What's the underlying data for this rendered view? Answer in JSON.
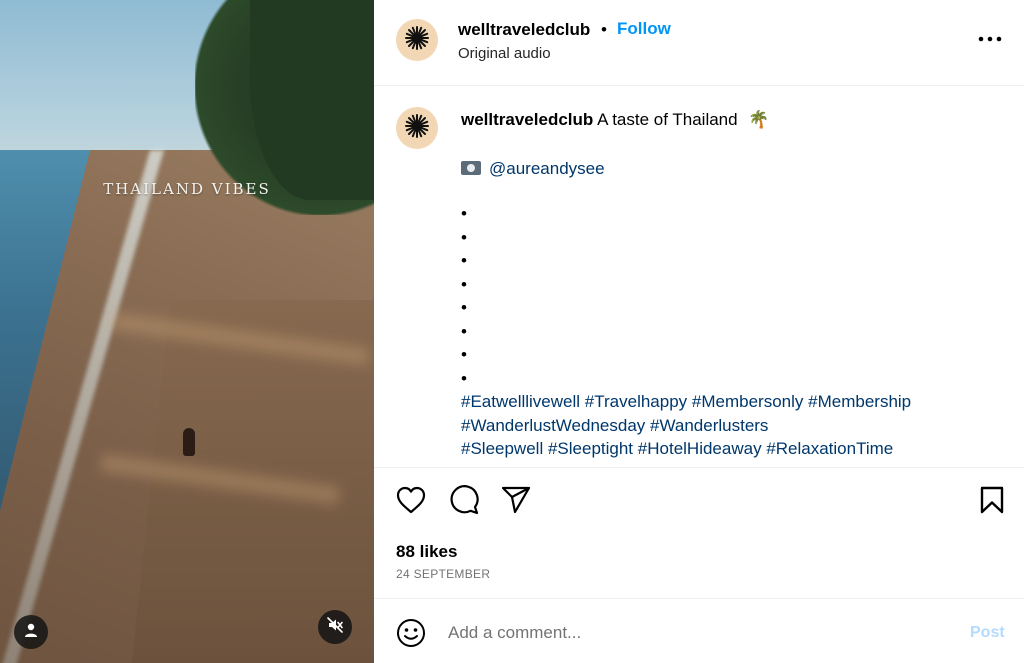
{
  "media": {
    "overlay_text": "THAILAND VIBES",
    "user_tag_icon": "person-icon",
    "mute_icon": "speaker-muted-icon"
  },
  "header": {
    "username": "welltraveledclub",
    "separator": "•",
    "follow_label": "Follow",
    "subtitle": "Original audio",
    "more_icon": "more-horizontal-icon"
  },
  "caption": {
    "username": "welltraveledclub",
    "text": "A taste of Thailand",
    "emoji": "🌴",
    "credit_icon": "camera-icon",
    "credit_handle": "@aureandysee",
    "bullets": [
      "•",
      "•",
      "•",
      "•",
      "•",
      "•",
      "•",
      "•"
    ],
    "hashtags": [
      "#Eatwelllivewell",
      "#Travelhappy",
      "#Membersonly",
      "#Membership",
      "#WanderlustWednesday",
      "#Wanderlusters",
      "#Sleepwell",
      "#Sleeptight",
      "#HotelHideaway",
      "#RelaxationTime"
    ]
  },
  "actions": {
    "like_icon": "heart-icon",
    "comment_icon": "comment-icon",
    "share_icon": "paper-plane-icon",
    "save_icon": "bookmark-icon"
  },
  "likes_text": "88 likes",
  "date_text": "24 SEPTEMBER",
  "comment_bar": {
    "emoji_icon": "smiley-icon",
    "placeholder": "Add a comment...",
    "post_label": "Post"
  },
  "colors": {
    "link_blue": "#0095f6",
    "hashtag_blue": "#00376b",
    "post_disabled": "#b3dbff",
    "avatar_bg": "#f2d7b4"
  }
}
